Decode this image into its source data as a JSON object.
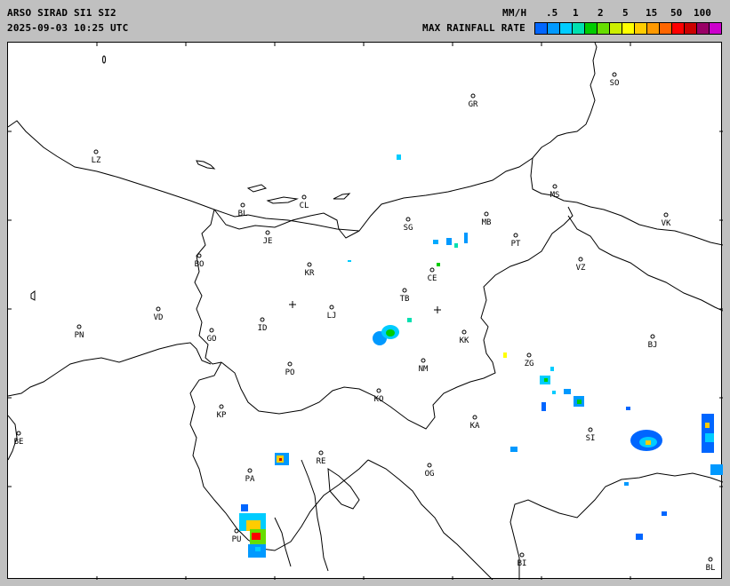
{
  "header": {
    "title": "ARSO SIRAD SI1 SI2",
    "timestamp": "2025-09-03 10:25 UTC",
    "units_label": "MM/H",
    "legend_title": "MAX RAINFALL RATE"
  },
  "legend": {
    "ticks": [
      ".5",
      "1",
      "2",
      "5",
      "15",
      "50",
      "100"
    ],
    "colors": [
      "#0066ff",
      "#0099ff",
      "#00ccff",
      "#00e0b0",
      "#00cc00",
      "#66dd00",
      "#ccee00",
      "#ffff00",
      "#ffcc00",
      "#ff9900",
      "#ff6600",
      "#ff0000",
      "#cc0000",
      "#990066",
      "#cc00cc"
    ]
  },
  "cities": [
    {
      "code": "SO"
    },
    {
      "code": "GR"
    },
    {
      "code": "LZ"
    },
    {
      "code": "BL"
    },
    {
      "code": "CL"
    },
    {
      "code": "MS"
    },
    {
      "code": "MB"
    },
    {
      "code": "SG"
    },
    {
      "code": "VK"
    },
    {
      "code": "JE"
    },
    {
      "code": "PT"
    },
    {
      "code": "BO"
    },
    {
      "code": "KR"
    },
    {
      "code": "CE"
    },
    {
      "code": "VZ"
    },
    {
      "code": "TB"
    },
    {
      "code": "VD"
    },
    {
      "code": "LJ"
    },
    {
      "code": "PN"
    },
    {
      "code": "ID"
    },
    {
      "code": "GO"
    },
    {
      "code": "KK"
    },
    {
      "code": "BJ"
    },
    {
      "code": "ZG"
    },
    {
      "code": "PO"
    },
    {
      "code": "NM"
    },
    {
      "code": "KO"
    },
    {
      "code": "KP"
    },
    {
      "code": "KA"
    },
    {
      "code": "BE"
    },
    {
      "code": "SI"
    },
    {
      "code": "RE"
    },
    {
      "code": "PA"
    },
    {
      "code": "OG"
    },
    {
      "code": "PU"
    },
    {
      "code": "BI"
    },
    {
      "code": "BL"
    }
  ],
  "colors": {
    "background": "#c0c0c0",
    "map": "#ffffff",
    "border_lines": "#000000"
  }
}
